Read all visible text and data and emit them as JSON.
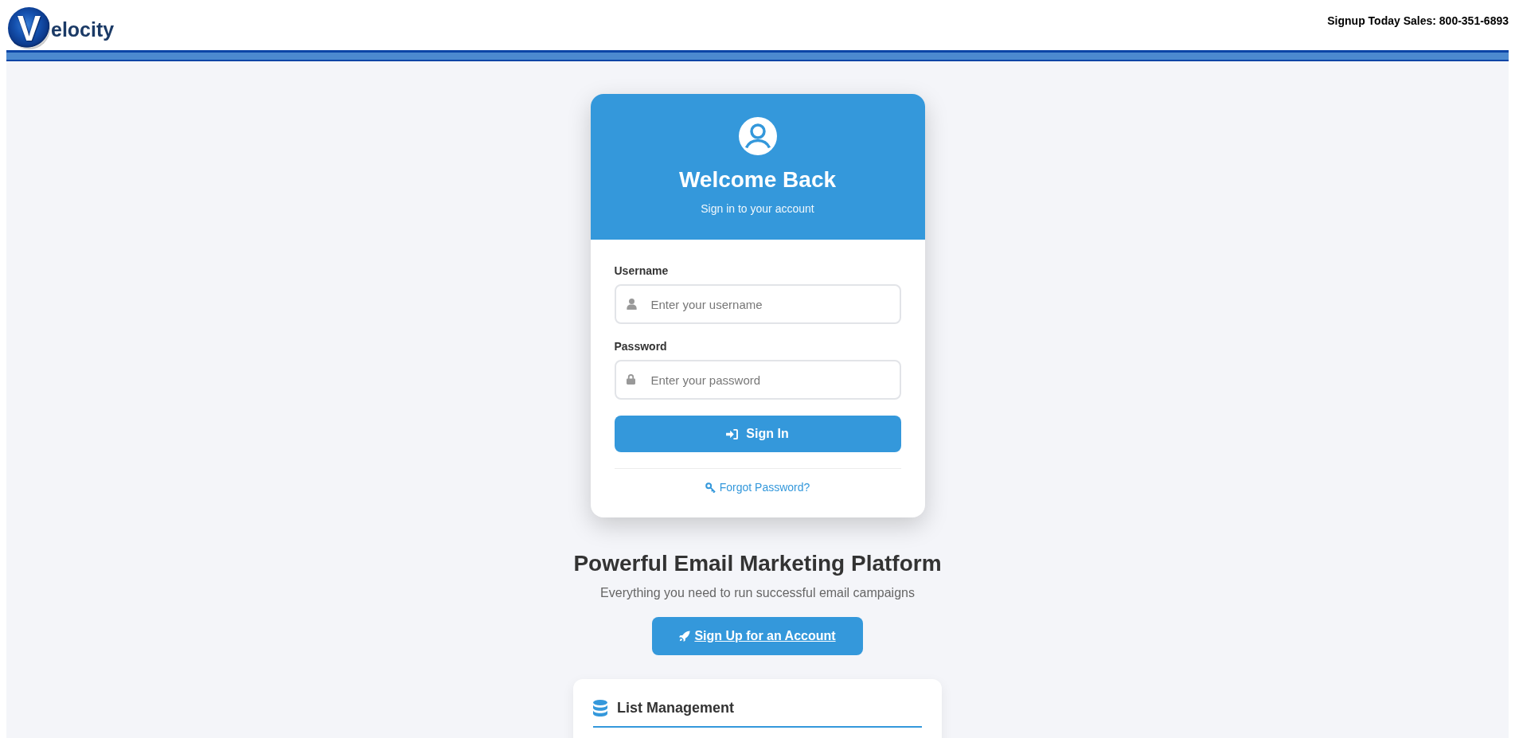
{
  "header": {
    "logo": {
      "letter": "V",
      "text": "elocity"
    },
    "sales_line": "Signup Today Sales: 800-351-6893"
  },
  "login_card": {
    "title": "Welcome Back",
    "subtitle": "Sign in to your account",
    "fields": [
      {
        "kind": "username",
        "label": "Username",
        "placeholder": "Enter your username"
      },
      {
        "kind": "password",
        "label": "Password",
        "placeholder": "Enter your password"
      }
    ],
    "submit": "Sign In",
    "forgot_link": "Forgot Password?"
  },
  "promo": {
    "title": "Powerful Email Marketing Platform",
    "subtitle": "Everything you need to run successful email campaigns",
    "signup_button": "Sign Up for an Account"
  },
  "features": [
    {
      "title": "List Management"
    }
  ]
}
